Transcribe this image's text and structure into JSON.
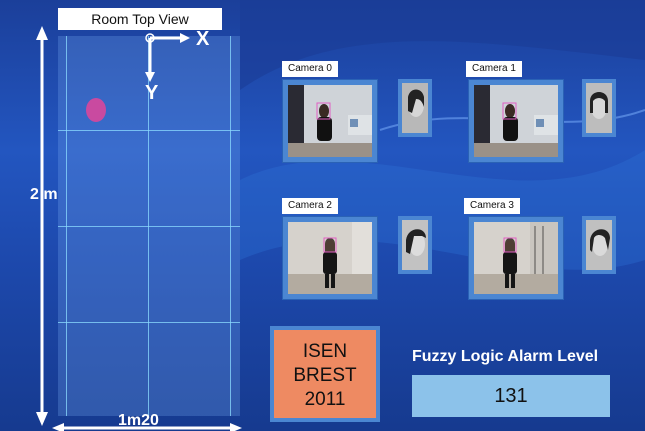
{
  "room": {
    "title": "Room Top View",
    "axis_x": "X",
    "axis_y": "Y",
    "height_label": "2 m",
    "width_label": "1m20"
  },
  "cameras": [
    {
      "label": "Camera 0"
    },
    {
      "label": "Camera 1"
    },
    {
      "label": "Camera 2"
    },
    {
      "label": "Camera 3"
    }
  ],
  "logo": {
    "line1": "ISEN",
    "line2": "BREST",
    "line3": "2011"
  },
  "alarm": {
    "title": "Fuzzy Logic Alarm Level",
    "value": "131"
  },
  "colors": {
    "background": "#1d49ad",
    "frame": "#4b86d2",
    "person_marker": "#c94aa0",
    "logo_bg": "#ee8a62",
    "alarm_bg": "#8cc2ea"
  }
}
